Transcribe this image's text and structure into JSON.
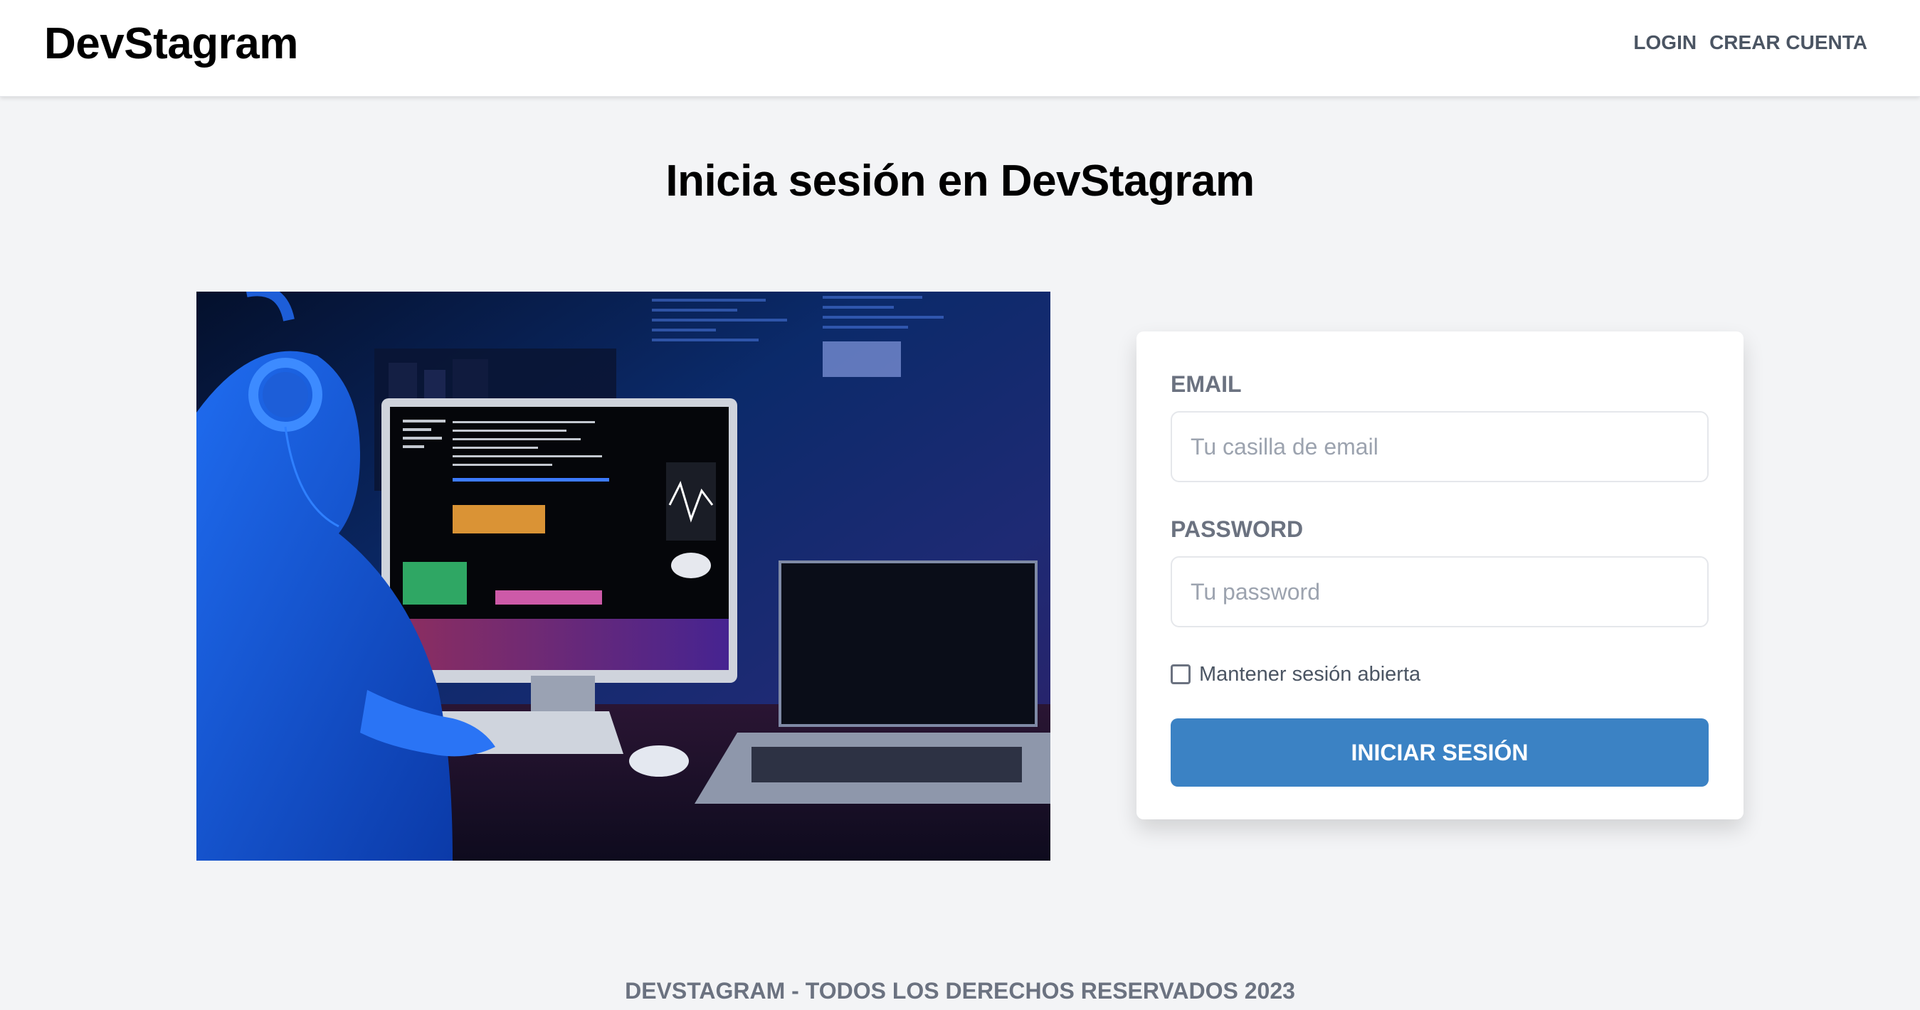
{
  "header": {
    "logo": "DevStagram",
    "nav": {
      "login": "LOGIN",
      "register": "CREAR CUENTA"
    }
  },
  "main": {
    "title": "Inicia sesión en DevStagram",
    "form": {
      "email_label": "EMAIL",
      "email_placeholder": "Tu casilla de email",
      "email_value": "",
      "password_label": "PASSWORD",
      "password_placeholder": "Tu password",
      "password_value": "",
      "remember_label": "Mantener sesión abierta",
      "remember_checked": false,
      "submit_label": "INICIAR SESIÓN"
    }
  },
  "footer": {
    "text": "DEVSTAGRAM - TODOS LOS DERECHOS RESERVADOS 2023"
  },
  "colors": {
    "background": "#f3f4f6",
    "primary_button": "#3b82c4",
    "label_text": "#6b7280"
  },
  "icons": {
    "remember": "checkbox-unchecked"
  }
}
